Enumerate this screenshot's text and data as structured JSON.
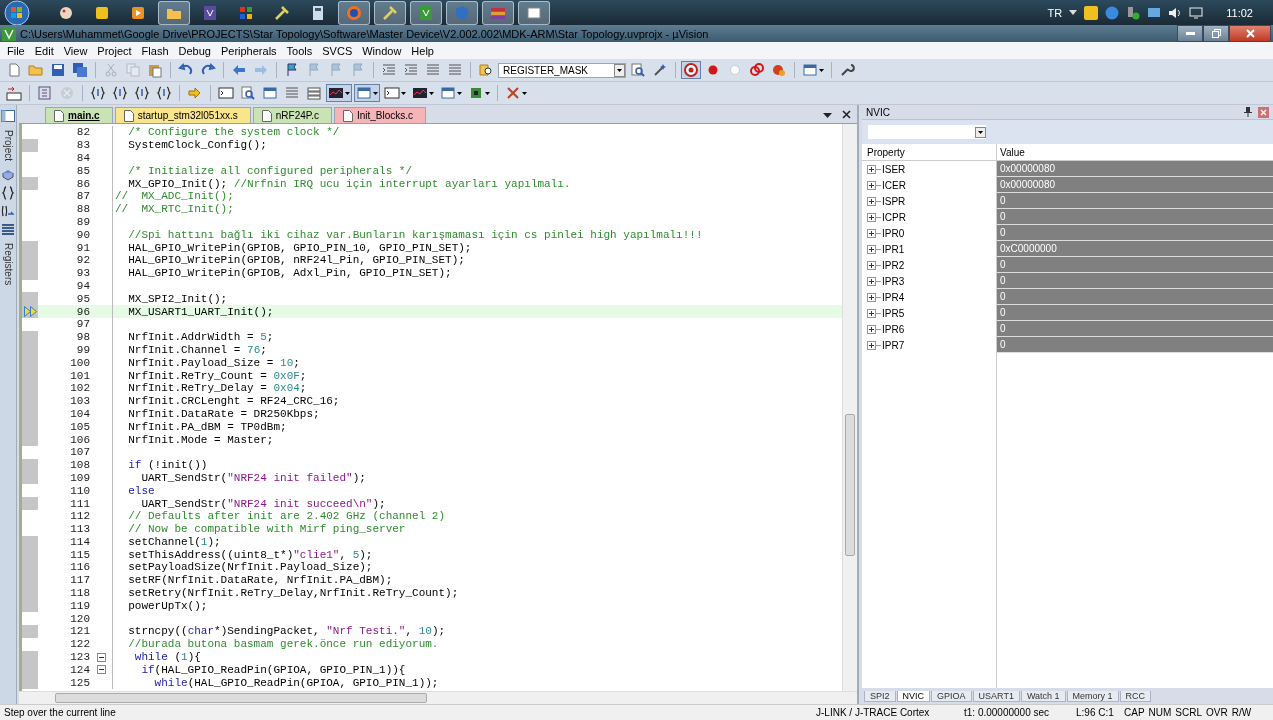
{
  "taskbar": {
    "apps": [
      {
        "kind": "paint",
        "active": false
      },
      {
        "kind": "yellow",
        "active": false
      },
      {
        "kind": "media",
        "active": false
      },
      {
        "kind": "folder",
        "active": true
      },
      {
        "kind": "studio",
        "active": false
      },
      {
        "kind": "tiles",
        "active": false
      },
      {
        "kind": "tool",
        "active": false
      },
      {
        "kind": "calc",
        "active": false
      },
      {
        "kind": "browser",
        "active": true
      },
      {
        "kind": "tool",
        "active": true
      },
      {
        "kind": "ide",
        "active": true
      },
      {
        "kind": "shield",
        "active": true
      },
      {
        "kind": "layers",
        "active": true
      },
      {
        "kind": "window",
        "active": true
      }
    ],
    "language": "TR",
    "clock": "11:02"
  },
  "window": {
    "title": "C:\\Users\\Muhammet\\Google Drive\\PROJECTS\\Star Topology\\Software\\Master Device\\V2.002.002\\MDK-ARM\\Star Topology.uvprojx - µVision"
  },
  "menu": [
    "File",
    "Edit",
    "View",
    "Project",
    "Flash",
    "Debug",
    "Peripherals",
    "Tools",
    "SVCS",
    "Window",
    "Help"
  ],
  "toolbar_1": [
    {
      "kind": "doc",
      "disabled": false
    },
    {
      "kind": "folder",
      "disabled": false
    },
    {
      "kind": "disk",
      "disabled": false
    },
    {
      "kind": "disks",
      "disabled": false
    },
    {
      "kind": "sep"
    },
    {
      "kind": "scissors",
      "disabled": true
    },
    {
      "kind": "copy",
      "disabled": true
    },
    {
      "kind": "paste",
      "disabled": false
    },
    {
      "kind": "sep"
    },
    {
      "kind": "undo",
      "disabled": false
    },
    {
      "kind": "redo",
      "disabled": false
    },
    {
      "kind": "sep"
    },
    {
      "kind": "back",
      "disabled": false
    },
    {
      "kind": "fwd",
      "disabled": true
    },
    {
      "kind": "sep"
    },
    {
      "kind": "flag",
      "disabled": false
    },
    {
      "kind": "flag",
      "disabled": true
    },
    {
      "kind": "flag",
      "disabled": true
    },
    {
      "kind": "flag",
      "disabled": true
    },
    {
      "kind": "sep"
    },
    {
      "kind": "indent",
      "disabled": false
    },
    {
      "kind": "indent",
      "disabled": false
    },
    {
      "kind": "lines",
      "disabled": false
    },
    {
      "kind": "lines",
      "disabled": false
    },
    {
      "kind": "sep"
    },
    {
      "kind": "findfiles",
      "disabled": false
    },
    {
      "kind": "combo",
      "value": "REGISTER_MASK"
    },
    {
      "kind": "search",
      "disabled": false
    },
    {
      "kind": "config",
      "disabled": false
    },
    {
      "kind": "sep"
    },
    {
      "kind": "debug",
      "disabled": false,
      "pressed": true
    },
    {
      "kind": "dot",
      "disabled": false
    },
    {
      "kind": "ring",
      "disabled": false
    },
    {
      "kind": "kill",
      "disabled": false
    },
    {
      "kind": "killall",
      "disabled": false
    },
    {
      "kind": "sep"
    },
    {
      "kind": "window",
      "disabled": false,
      "dropdown": true
    },
    {
      "kind": "sep"
    },
    {
      "kind": "wrench",
      "disabled": false
    }
  ],
  "toolbar_2": [
    {
      "kind": "rst",
      "disabled": false
    },
    {
      "kind": "sep"
    },
    {
      "kind": "run",
      "disabled": false
    },
    {
      "kind": "stop",
      "disabled": true
    },
    {
      "kind": "sep"
    },
    {
      "kind": "braces",
      "disabled": false
    },
    {
      "kind": "braces",
      "disabled": false
    },
    {
      "kind": "braces",
      "disabled": false
    },
    {
      "kind": "braces",
      "disabled": false
    },
    {
      "kind": "sep"
    },
    {
      "kind": "arrow",
      "disabled": false
    },
    {
      "kind": "sep"
    },
    {
      "kind": "terminal",
      "disabled": false
    },
    {
      "kind": "search",
      "disabled": false
    },
    {
      "kind": "window",
      "disabled": false
    },
    {
      "kind": "lines",
      "disabled": false
    },
    {
      "kind": "stack",
      "disabled": false
    },
    {
      "kind": "chart",
      "disabled": false,
      "dropdown": true,
      "pressed": true
    },
    {
      "kind": "window",
      "disabled": false,
      "dropdown": true,
      "pressed": true
    },
    {
      "kind": "terminal",
      "disabled": false,
      "dropdown": true
    },
    {
      "kind": "chart",
      "disabled": false,
      "dropdown": true
    },
    {
      "kind": "window",
      "disabled": false,
      "dropdown": true
    },
    {
      "kind": "chip",
      "disabled": false,
      "dropdown": true
    },
    {
      "kind": "sep"
    },
    {
      "kind": "tools",
      "disabled": false,
      "dropdown": true
    }
  ],
  "side_tabs": [
    {
      "label": "Project",
      "selected": false
    },
    {
      "label": "Registers",
      "selected": false
    }
  ],
  "editor": {
    "tabs": [
      {
        "label": "main.c",
        "selected": true,
        "color": "#c9e3b4"
      },
      {
        "label": "startup_stm32l051xx.s",
        "selected": false,
        "color": "#f8e58c"
      },
      {
        "label": "nRF24P.c",
        "selected": false,
        "color": "#c9e3b4"
      },
      {
        "label": "Init_Blocks.c",
        "selected": false,
        "color": "#f4b4b8"
      }
    ],
    "lines": [
      {
        "number": "82",
        "executable": false,
        "current": false,
        "fold": false,
        "tokens": [
          {
            "kind": "comment",
            "text": "  /* Configure the system clock */"
          }
        ]
      },
      {
        "number": "83",
        "executable": true,
        "current": false,
        "fold": false,
        "tokens": [
          {
            "kind": "plain",
            "text": "  SystemClock_Config();"
          }
        ]
      },
      {
        "number": "84",
        "executable": false,
        "current": false,
        "fold": false
      },
      {
        "number": "85",
        "executable": false,
        "current": false,
        "fold": false,
        "tokens": [
          {
            "kind": "comment",
            "text": "  /* Initialize all configured peripherals */"
          }
        ]
      },
      {
        "number": "86",
        "executable": true,
        "current": false,
        "fold": false,
        "tokens": [
          {
            "kind": "plain",
            "text": "  MX_GPIO_Init(); "
          },
          {
            "kind": "comment",
            "text": "//Nrfnin IRQ ucu için interrupt ayarları yapılmalı."
          }
        ]
      },
      {
        "number": "87",
        "executable": false,
        "current": false,
        "fold": false,
        "tokens": [
          {
            "kind": "comment",
            "text": "//  MX_ADC_Init();"
          }
        ]
      },
      {
        "number": "88",
        "executable": false,
        "current": false,
        "fold": false,
        "tokens": [
          {
            "kind": "comment",
            "text": "//  MX_RTC_Init();"
          }
        ]
      },
      {
        "number": "89",
        "executable": false,
        "current": false,
        "fold": false
      },
      {
        "number": "90",
        "executable": false,
        "current": false,
        "fold": false,
        "tokens": [
          {
            "kind": "comment",
            "text": "  //Spi hattını bağlı iki cihaz var.Bunların karışmaması için cs pinlei high yapılmalı!!!"
          }
        ]
      },
      {
        "number": "91",
        "executable": true,
        "current": false,
        "fold": false,
        "tokens": [
          {
            "kind": "plain",
            "text": "  HAL_GPIO_WritePin(GPIOB, GPIO_PIN_10, GPIO_PIN_SET);"
          }
        ]
      },
      {
        "number": "92",
        "executable": true,
        "current": false,
        "fold": false,
        "tokens": [
          {
            "kind": "plain",
            "text": "  HAL_GPIO_WritePin(GPIOB, nRF24l_Pin, GPIO_PIN_SET);"
          }
        ]
      },
      {
        "number": "93",
        "executable": true,
        "current": false,
        "fold": false,
        "tokens": [
          {
            "kind": "plain",
            "text": "  HAL_GPIO_WritePin(GPIOB, Adxl_Pin, GPIO_PIN_SET);"
          }
        ]
      },
      {
        "number": "94",
        "executable": false,
        "current": false,
        "fold": false
      },
      {
        "number": "95",
        "executable": true,
        "current": false,
        "fold": false,
        "tokens": [
          {
            "kind": "plain",
            "text": "  MX_SPI2_Init();"
          }
        ]
      },
      {
        "number": "96",
        "executable": true,
        "current": true,
        "fold": false,
        "tokens": [
          {
            "kind": "plain",
            "text": "  MX_USART1_UART_Init();"
          }
        ]
      },
      {
        "number": "97",
        "executable": false,
        "current": false,
        "fold": false
      },
      {
        "number": "98",
        "executable": true,
        "current": false,
        "fold": false,
        "tokens": [
          {
            "kind": "plain",
            "text": "  NrfInit.AddrWidth = "
          },
          {
            "kind": "number",
            "text": "5"
          },
          {
            "kind": "plain",
            "text": ";"
          }
        ]
      },
      {
        "number": "99",
        "executable": true,
        "current": false,
        "fold": false,
        "tokens": [
          {
            "kind": "plain",
            "text": "  NrfInit.Channel = "
          },
          {
            "kind": "number",
            "text": "76"
          },
          {
            "kind": "plain",
            "text": ";"
          }
        ]
      },
      {
        "number": "100",
        "executable": true,
        "current": false,
        "fold": false,
        "tokens": [
          {
            "kind": "plain",
            "text": "  NrfInit.Payload_Size = "
          },
          {
            "kind": "number",
            "text": "10"
          },
          {
            "kind": "plain",
            "text": ";"
          }
        ]
      },
      {
        "number": "101",
        "executable": true,
        "current": false,
        "fold": false,
        "tokens": [
          {
            "kind": "plain",
            "text": "  NrfInit.ReTry_Count = "
          },
          {
            "kind": "number",
            "text": "0x0F"
          },
          {
            "kind": "plain",
            "text": ";"
          }
        ]
      },
      {
        "number": "102",
        "executable": true,
        "current": false,
        "fold": false,
        "tokens": [
          {
            "kind": "plain",
            "text": "  NrfInit.ReTry_Delay = "
          },
          {
            "kind": "number",
            "text": "0x04"
          },
          {
            "kind": "plain",
            "text": ";"
          }
        ]
      },
      {
        "number": "103",
        "executable": true,
        "current": false,
        "fold": false,
        "tokens": [
          {
            "kind": "plain",
            "text": "  NrfInit.CRCLenght = RF24_CRC_16;"
          }
        ]
      },
      {
        "number": "104",
        "executable": true,
        "current": false,
        "fold": false,
        "tokens": [
          {
            "kind": "plain",
            "text": "  NrfInit.DataRate = DR250Kbps;"
          }
        ]
      },
      {
        "number": "105",
        "executable": true,
        "current": false,
        "fold": false,
        "tokens": [
          {
            "kind": "plain",
            "text": "  NrfInit.PA_dBM = TP0dBm;"
          }
        ]
      },
      {
        "number": "106",
        "executable": true,
        "current": false,
        "fold": false,
        "tokens": [
          {
            "kind": "plain",
            "text": "  NrfInit.Mode = Master;"
          }
        ]
      },
      {
        "number": "107",
        "executable": false,
        "current": false,
        "fold": false
      },
      {
        "number": "108",
        "executable": true,
        "current": false,
        "fold": false,
        "tokens": [
          {
            "kind": "keyword",
            "text": "  if"
          },
          {
            "kind": "plain",
            "text": " (!init())"
          }
        ]
      },
      {
        "number": "109",
        "executable": true,
        "current": false,
        "fold": false,
        "tokens": [
          {
            "kind": "plain",
            "text": "    UART_SendStr("
          },
          {
            "kind": "string",
            "text": "\"NRF24 init failed\""
          },
          {
            "kind": "plain",
            "text": ");"
          }
        ]
      },
      {
        "number": "110",
        "executable": false,
        "current": false,
        "fold": false,
        "tokens": [
          {
            "kind": "keyword",
            "text": "  else"
          }
        ]
      },
      {
        "number": "111",
        "executable": true,
        "current": false,
        "fold": false,
        "tokens": [
          {
            "kind": "plain",
            "text": "    UART_SendStr("
          },
          {
            "kind": "string",
            "text": "\"NRF24 init succeed\\n\""
          },
          {
            "kind": "plain",
            "text": ");"
          }
        ]
      },
      {
        "number": "112",
        "executable": false,
        "current": false,
        "fold": false,
        "tokens": [
          {
            "kind": "comment",
            "text": "  // Defaults after init are 2.402 GHz (channel 2)"
          }
        ]
      },
      {
        "number": "113",
        "executable": false,
        "current": false,
        "fold": false,
        "tokens": [
          {
            "kind": "comment",
            "text": "  // Now be compatible with Mirf ping_server"
          }
        ]
      },
      {
        "number": "114",
        "executable": true,
        "current": false,
        "fold": false,
        "tokens": [
          {
            "kind": "plain",
            "text": "  setChannel("
          },
          {
            "kind": "number",
            "text": "1"
          },
          {
            "kind": "plain",
            "text": ");"
          }
        ]
      },
      {
        "number": "115",
        "executable": true,
        "current": false,
        "fold": false,
        "tokens": [
          {
            "kind": "plain",
            "text": "  setThisAddress((uint8_t*)"
          },
          {
            "kind": "string",
            "text": "\"clie1\""
          },
          {
            "kind": "plain",
            "text": ", "
          },
          {
            "kind": "number",
            "text": "5"
          },
          {
            "kind": "plain",
            "text": ");"
          }
        ]
      },
      {
        "number": "116",
        "executable": true,
        "current": false,
        "fold": false,
        "tokens": [
          {
            "kind": "plain",
            "text": "  setPayloadSize(NrfInit.Payload_Size);"
          }
        ]
      },
      {
        "number": "117",
        "executable": true,
        "current": false,
        "fold": false,
        "tokens": [
          {
            "kind": "plain",
            "text": "  setRF(NrfInit.DataRate, NrfInit.PA_dBM);"
          }
        ]
      },
      {
        "number": "118",
        "executable": true,
        "current": false,
        "fold": false,
        "tokens": [
          {
            "kind": "plain",
            "text": "  setRetry(NrfInit.ReTry_Delay,NrfInit.ReTry_Count);"
          }
        ]
      },
      {
        "number": "119",
        "executable": true,
        "current": false,
        "fold": false,
        "tokens": [
          {
            "kind": "plain",
            "text": "  powerUpTx();"
          }
        ]
      },
      {
        "number": "120",
        "executable": false,
        "current": false,
        "fold": false
      },
      {
        "number": "121",
        "executable": true,
        "current": false,
        "fold": false,
        "tokens": [
          {
            "kind": "plain",
            "text": "  strncpy(("
          },
          {
            "kind": "keyword",
            "text": "char"
          },
          {
            "kind": "plain",
            "text": "*)SendingPacket, "
          },
          {
            "kind": "string",
            "text": "\"Nrf Testi.\""
          },
          {
            "kind": "plain",
            "text": ", "
          },
          {
            "kind": "number",
            "text": "10"
          },
          {
            "kind": "plain",
            "text": ");"
          }
        ]
      },
      {
        "number": "122",
        "executable": false,
        "current": false,
        "fold": false,
        "tokens": [
          {
            "kind": "comment",
            "text": "  //burada butona basmam gerek.önce run ediyorum."
          }
        ]
      },
      {
        "number": "123",
        "executable": true,
        "current": false,
        "fold": true,
        "tokens": [
          {
            "kind": "keyword",
            "text": "   while"
          },
          {
            "kind": "plain",
            "text": " ("
          },
          {
            "kind": "number",
            "text": "1"
          },
          {
            "kind": "plain",
            "text": "){"
          }
        ]
      },
      {
        "number": "124",
        "executable": true,
        "current": false,
        "fold": true,
        "tokens": [
          {
            "kind": "keyword",
            "text": "    if"
          },
          {
            "kind": "plain",
            "text": "(HAL_GPIO_ReadPin(GPIOA, GPIO_PIN_1)){"
          }
        ]
      },
      {
        "number": "125",
        "executable": true,
        "current": false,
        "fold": false,
        "tokens": [
          {
            "kind": "keyword",
            "text": "      while"
          },
          {
            "kind": "plain",
            "text": "(HAL_GPIO_ReadPin(GPIOA, GPIO_PIN_1));"
          }
        ]
      }
    ]
  },
  "nvic": {
    "title": "NVIC",
    "columns": [
      "Property",
      "Value"
    ],
    "rows": [
      {
        "property": "ISER",
        "value": "0x00000080"
      },
      {
        "property": "ICER",
        "value": "0x00000080"
      },
      {
        "property": "ISPR",
        "value": "0"
      },
      {
        "property": "ICPR",
        "value": "0"
      },
      {
        "property": "IPR0",
        "value": "0"
      },
      {
        "property": "IPR1",
        "value": "0xC0000000"
      },
      {
        "property": "IPR2",
        "value": "0"
      },
      {
        "property": "IPR3",
        "value": "0"
      },
      {
        "property": "IPR4",
        "value": "0"
      },
      {
        "property": "IPR5",
        "value": "0"
      },
      {
        "property": "IPR6",
        "value": "0"
      },
      {
        "property": "IPR7",
        "value": "0"
      }
    ],
    "tabs": [
      {
        "label": "SPI2",
        "selected": false
      },
      {
        "label": "NVIC",
        "selected": true
      },
      {
        "label": "GPIOA",
        "selected": false
      },
      {
        "label": "USART1",
        "selected": false
      },
      {
        "label": "Watch 1",
        "selected": false
      },
      {
        "label": "Memory 1",
        "selected": false
      },
      {
        "label": "RCC",
        "selected": false
      }
    ]
  },
  "status_bar": {
    "message": "Step over the current line",
    "debugger": "J-LINK / J-TRACE Cortex",
    "time": "t1: 0.00000000 sec",
    "position": "L:96 C:1",
    "indicators": [
      "CAP",
      "NUM",
      "SCRL",
      "OVR",
      "R/W"
    ]
  }
}
